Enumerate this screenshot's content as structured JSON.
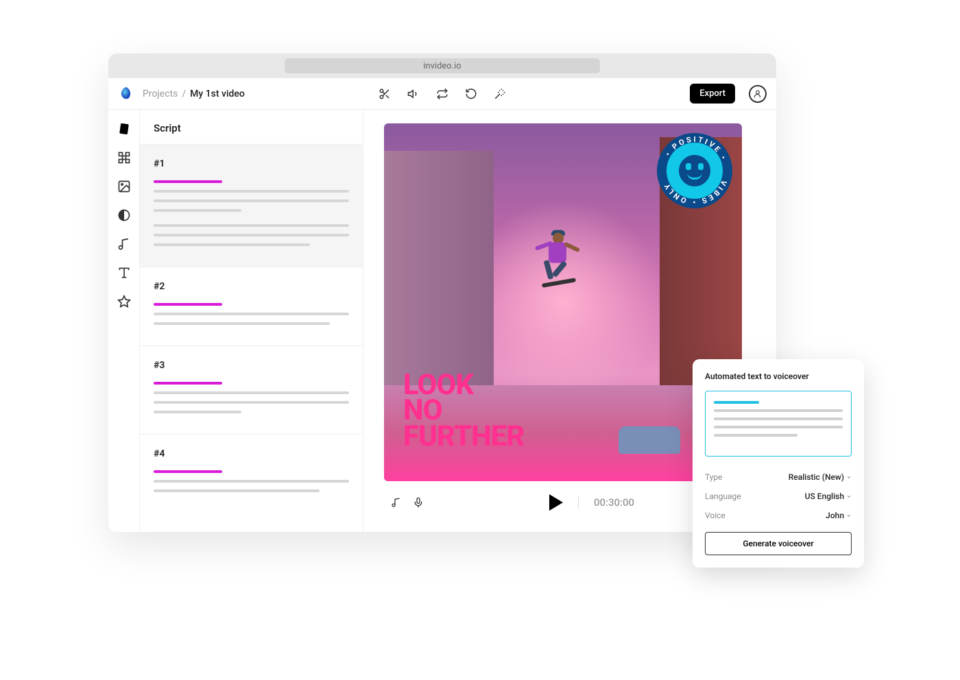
{
  "browser": {
    "url": "invideo.io"
  },
  "breadcrumb": {
    "root": "Projects",
    "sep": "/",
    "current": "My 1st video"
  },
  "header": {
    "export_label": "Export"
  },
  "script": {
    "title": "Script",
    "blocks": [
      {
        "num": "#1"
      },
      {
        "num": "#2"
      },
      {
        "num": "#3"
      },
      {
        "num": "#4"
      }
    ]
  },
  "canvas": {
    "headline_l1": "LOOK",
    "headline_l2": "NO",
    "headline_l3": "FURTHER",
    "badge_top": "• POSITIVE •",
    "badge_bottom": "VIBES • ONLY"
  },
  "playback": {
    "timecode": "00:30:00"
  },
  "voiceover": {
    "title": "Automated text to voiceover",
    "fields": {
      "type_label": "Type",
      "type_value": "Realistic (New)",
      "lang_label": "Language",
      "lang_value": "US English",
      "voice_label": "Voice",
      "voice_value": "John"
    },
    "generate_label": "Generate voiceover"
  }
}
